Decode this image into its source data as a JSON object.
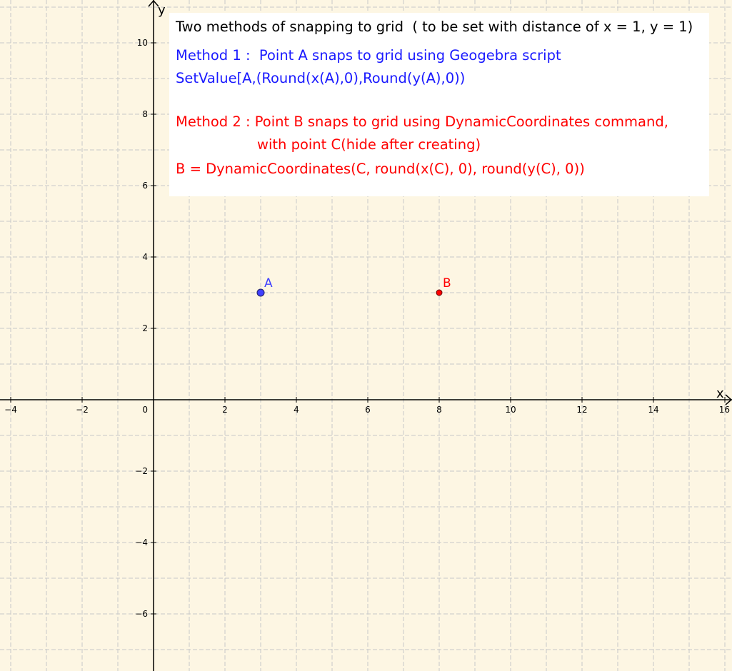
{
  "colors": {
    "background": "#fdf6e3",
    "grid": "#c8c8c8",
    "axis": "#000000",
    "point_a": "#4040ff",
    "point_b": "#ff0000",
    "method1_text": "#1a1aff",
    "method2_text": "#ff0000"
  },
  "axes": {
    "x_label": "x",
    "y_label": "y",
    "x_range": [
      -4.3,
      16.2
    ],
    "y_range": [
      -7.6,
      11.2
    ],
    "x_ticks": [
      -4,
      -2,
      0,
      2,
      4,
      6,
      8,
      10,
      12,
      14,
      16
    ],
    "y_ticks": [
      -6,
      -4,
      -2,
      2,
      4,
      6,
      8,
      10
    ],
    "grid": true,
    "grid_step": 1
  },
  "points": [
    {
      "name": "A",
      "x": 3,
      "y": 3
    },
    {
      "name": "B",
      "x": 8,
      "y": 3
    }
  ],
  "note": {
    "line1": "Two methods of snapping to grid  ( to be set with distance of x = 1, y = 1)",
    "line2": "Method 1 :  Point A snaps to grid using Geogebra script",
    "line3": "SetValue[A,(Round(x(A),0),Round(y(A),0))",
    "line4": "Method 2 : Point B snaps to grid using DynamicCoordinates command,",
    "line5": "with point C(hide after creating)",
    "line6": "B = DynamicCoordinates(C, round(x(C), 0), round(y(C), 0))"
  }
}
